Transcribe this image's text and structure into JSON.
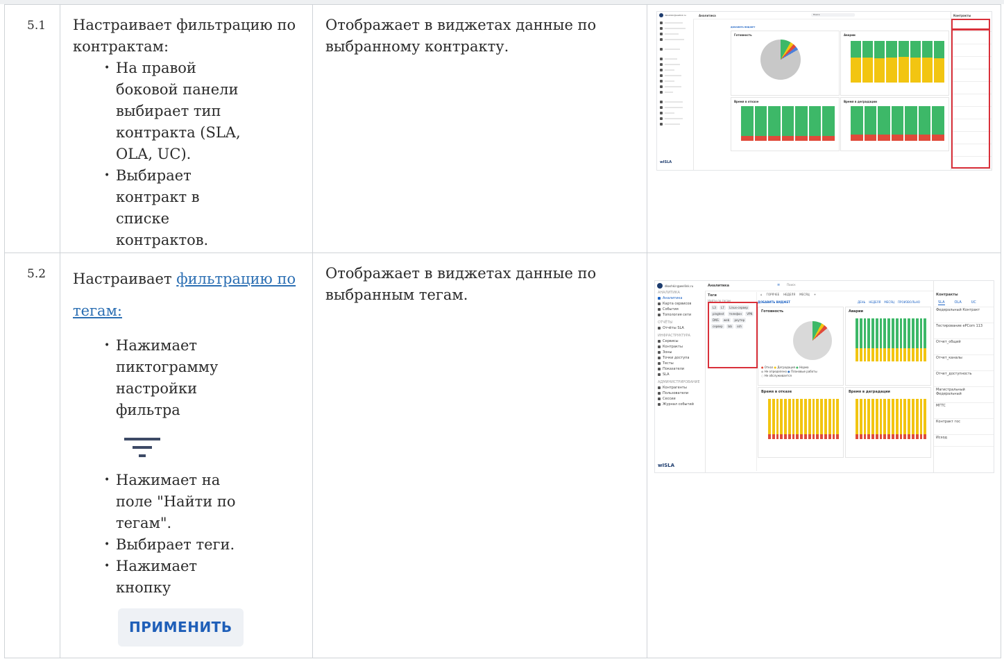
{
  "rows": [
    {
      "num": "5.1",
      "action_text": "Настраивает фильтрацию по контрактам:",
      "substeps": [
        "На правой боковой панели выбирает тип контракта (SLA, OLA, UC).",
        "Выбирает контракт в списке контрактов."
      ],
      "result": "Отображает в виджетах данные по выбранному контракту."
    },
    {
      "num": "5.2",
      "action_prefix": "Настраивает ",
      "action_link": "фильтрацию по тегам:",
      "substep1": "Нажимает пиктограмму настройки фильтра",
      "substep2": "Нажимает на поле \"Найти по тегам\".",
      "substep3": "Выбирает теги.",
      "substep4": "Нажимает кнопку",
      "apply_button": "ПРИМЕНИТЬ",
      "result": "Отображает в виджетах данные по выбранным тегам."
    }
  ],
  "screenshot2": {
    "user": "dkoshkin@wellink.ru",
    "section_title": "Аналитика",
    "search_placeholder": "Поиск",
    "tabs": [
      "ГОРЯЧЕЕ",
      "НЕДЕЛЯ",
      "МЕСЯЦ"
    ],
    "nav_header": "АНАЛИТИКА",
    "nav": [
      "Аналитика",
      "Карта сервисов",
      "События",
      "Топология сети"
    ],
    "reports_header": "ОТЧЁТЫ",
    "reports": [
      "Отчёты SLA"
    ],
    "infra_header": "ИНФРАСТРУКТУРА",
    "infra": [
      "Сервисы",
      "Контракты",
      "Зоны",
      "Точки доступа",
      "Тесты",
      "Показатели",
      "SLA"
    ],
    "admin_header": "АДМИНИСТРИРОВАНИЕ",
    "admin": [
      "Контрагенты",
      "Пользователи",
      "Сессии",
      "Журнал событий"
    ],
    "brand": "wISLA",
    "tags_title": "Теги",
    "tags_search": "Найти по тегам",
    "tags": [
      "L3",
      "L7",
      "Linux-сервер",
      "pingtest",
      "телефон",
      "VPN",
      "DNS",
      "web",
      "роутер",
      "сервер",
      "lab",
      "ssh"
    ],
    "add_widget": "ДОБАВИТЬ ВИДЖЕТ",
    "periods": [
      "ДЕНЬ",
      "НЕДЕЛЯ",
      "МЕСЯЦ",
      "ПРОИЗВОЛЬНО"
    ],
    "widgets": [
      "Готовность",
      "Аварии",
      "Время в отказе",
      "Время в деградации"
    ],
    "legend": [
      "Отказ",
      "Деградация",
      "Норма",
      "Не определено",
      "Плановые работы",
      "Не обслуживается"
    ],
    "contracts_title": "Контракты",
    "contract_types": [
      "SLA",
      "OLA",
      "UC"
    ],
    "contracts": [
      "Федеральный Контракт",
      "Тестирование ePCom 113",
      "Отчет_общий",
      "Отчет_каналы",
      "Отчет_доступность",
      "Магистральный Федеральный",
      "МГТС",
      "Контракт гос",
      "Исход"
    ]
  },
  "screenshot1": {
    "user": "dkoshkin@wellink.ru",
    "section_title": "Аналитика",
    "search_placeholder": "Поиск",
    "add_widget": "ДОБАВИТЬ ВИДЖЕТ",
    "widgets": [
      "Готовность",
      "Аварии",
      "Время в отказе",
      "Время в деградации"
    ],
    "contracts_title": "Контракты",
    "brand": "wISLA"
  },
  "colors": {
    "link": "#2c6fb3",
    "button_text": "#1f5fb8",
    "button_bg": "#eef1f5",
    "green": "#3db868",
    "yellow": "#f2c511",
    "red": "#e04a3a",
    "highlight": "#d9303a"
  },
  "icons": [
    "filter-icon"
  ]
}
